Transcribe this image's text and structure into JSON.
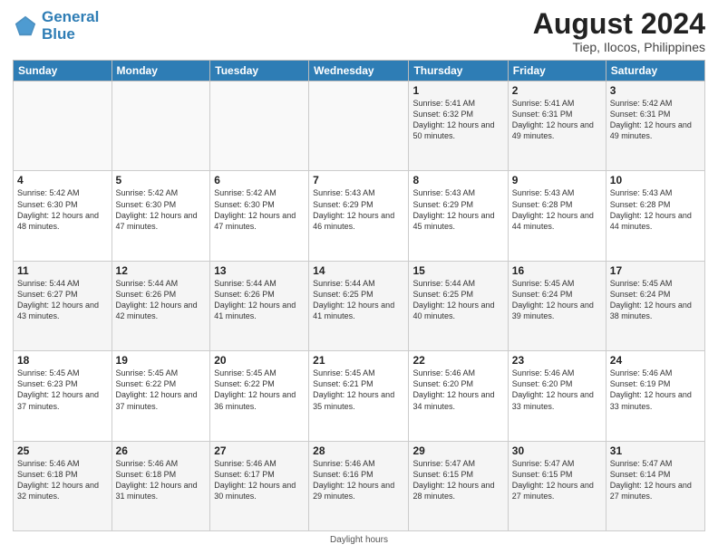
{
  "logo": {
    "text1": "General",
    "text2": "Blue"
  },
  "title": "August 2024",
  "subtitle": "Tiep, Ilocos, Philippines",
  "days_header": [
    "Sunday",
    "Monday",
    "Tuesday",
    "Wednesday",
    "Thursday",
    "Friday",
    "Saturday"
  ],
  "footer_note": "Daylight hours",
  "weeks": [
    [
      {
        "day": "",
        "sunrise": "",
        "sunset": "",
        "daylight": ""
      },
      {
        "day": "",
        "sunrise": "",
        "sunset": "",
        "daylight": ""
      },
      {
        "day": "",
        "sunrise": "",
        "sunset": "",
        "daylight": ""
      },
      {
        "day": "",
        "sunrise": "",
        "sunset": "",
        "daylight": ""
      },
      {
        "day": "1",
        "sunrise": "Sunrise: 5:41 AM",
        "sunset": "Sunset: 6:32 PM",
        "daylight": "Daylight: 12 hours and 50 minutes."
      },
      {
        "day": "2",
        "sunrise": "Sunrise: 5:41 AM",
        "sunset": "Sunset: 6:31 PM",
        "daylight": "Daylight: 12 hours and 49 minutes."
      },
      {
        "day": "3",
        "sunrise": "Sunrise: 5:42 AM",
        "sunset": "Sunset: 6:31 PM",
        "daylight": "Daylight: 12 hours and 49 minutes."
      }
    ],
    [
      {
        "day": "4",
        "sunrise": "Sunrise: 5:42 AM",
        "sunset": "Sunset: 6:30 PM",
        "daylight": "Daylight: 12 hours and 48 minutes."
      },
      {
        "day": "5",
        "sunrise": "Sunrise: 5:42 AM",
        "sunset": "Sunset: 6:30 PM",
        "daylight": "Daylight: 12 hours and 47 minutes."
      },
      {
        "day": "6",
        "sunrise": "Sunrise: 5:42 AM",
        "sunset": "Sunset: 6:30 PM",
        "daylight": "Daylight: 12 hours and 47 minutes."
      },
      {
        "day": "7",
        "sunrise": "Sunrise: 5:43 AM",
        "sunset": "Sunset: 6:29 PM",
        "daylight": "Daylight: 12 hours and 46 minutes."
      },
      {
        "day": "8",
        "sunrise": "Sunrise: 5:43 AM",
        "sunset": "Sunset: 6:29 PM",
        "daylight": "Daylight: 12 hours and 45 minutes."
      },
      {
        "day": "9",
        "sunrise": "Sunrise: 5:43 AM",
        "sunset": "Sunset: 6:28 PM",
        "daylight": "Daylight: 12 hours and 44 minutes."
      },
      {
        "day": "10",
        "sunrise": "Sunrise: 5:43 AM",
        "sunset": "Sunset: 6:28 PM",
        "daylight": "Daylight: 12 hours and 44 minutes."
      }
    ],
    [
      {
        "day": "11",
        "sunrise": "Sunrise: 5:44 AM",
        "sunset": "Sunset: 6:27 PM",
        "daylight": "Daylight: 12 hours and 43 minutes."
      },
      {
        "day": "12",
        "sunrise": "Sunrise: 5:44 AM",
        "sunset": "Sunset: 6:26 PM",
        "daylight": "Daylight: 12 hours and 42 minutes."
      },
      {
        "day": "13",
        "sunrise": "Sunrise: 5:44 AM",
        "sunset": "Sunset: 6:26 PM",
        "daylight": "Daylight: 12 hours and 41 minutes."
      },
      {
        "day": "14",
        "sunrise": "Sunrise: 5:44 AM",
        "sunset": "Sunset: 6:25 PM",
        "daylight": "Daylight: 12 hours and 41 minutes."
      },
      {
        "day": "15",
        "sunrise": "Sunrise: 5:44 AM",
        "sunset": "Sunset: 6:25 PM",
        "daylight": "Daylight: 12 hours and 40 minutes."
      },
      {
        "day": "16",
        "sunrise": "Sunrise: 5:45 AM",
        "sunset": "Sunset: 6:24 PM",
        "daylight": "Daylight: 12 hours and 39 minutes."
      },
      {
        "day": "17",
        "sunrise": "Sunrise: 5:45 AM",
        "sunset": "Sunset: 6:24 PM",
        "daylight": "Daylight: 12 hours and 38 minutes."
      }
    ],
    [
      {
        "day": "18",
        "sunrise": "Sunrise: 5:45 AM",
        "sunset": "Sunset: 6:23 PM",
        "daylight": "Daylight: 12 hours and 37 minutes."
      },
      {
        "day": "19",
        "sunrise": "Sunrise: 5:45 AM",
        "sunset": "Sunset: 6:22 PM",
        "daylight": "Daylight: 12 hours and 37 minutes."
      },
      {
        "day": "20",
        "sunrise": "Sunrise: 5:45 AM",
        "sunset": "Sunset: 6:22 PM",
        "daylight": "Daylight: 12 hours and 36 minutes."
      },
      {
        "day": "21",
        "sunrise": "Sunrise: 5:45 AM",
        "sunset": "Sunset: 6:21 PM",
        "daylight": "Daylight: 12 hours and 35 minutes."
      },
      {
        "day": "22",
        "sunrise": "Sunrise: 5:46 AM",
        "sunset": "Sunset: 6:20 PM",
        "daylight": "Daylight: 12 hours and 34 minutes."
      },
      {
        "day": "23",
        "sunrise": "Sunrise: 5:46 AM",
        "sunset": "Sunset: 6:20 PM",
        "daylight": "Daylight: 12 hours and 33 minutes."
      },
      {
        "day": "24",
        "sunrise": "Sunrise: 5:46 AM",
        "sunset": "Sunset: 6:19 PM",
        "daylight": "Daylight: 12 hours and 33 minutes."
      }
    ],
    [
      {
        "day": "25",
        "sunrise": "Sunrise: 5:46 AM",
        "sunset": "Sunset: 6:18 PM",
        "daylight": "Daylight: 12 hours and 32 minutes."
      },
      {
        "day": "26",
        "sunrise": "Sunrise: 5:46 AM",
        "sunset": "Sunset: 6:18 PM",
        "daylight": "Daylight: 12 hours and 31 minutes."
      },
      {
        "day": "27",
        "sunrise": "Sunrise: 5:46 AM",
        "sunset": "Sunset: 6:17 PM",
        "daylight": "Daylight: 12 hours and 30 minutes."
      },
      {
        "day": "28",
        "sunrise": "Sunrise: 5:46 AM",
        "sunset": "Sunset: 6:16 PM",
        "daylight": "Daylight: 12 hours and 29 minutes."
      },
      {
        "day": "29",
        "sunrise": "Sunrise: 5:47 AM",
        "sunset": "Sunset: 6:15 PM",
        "daylight": "Daylight: 12 hours and 28 minutes."
      },
      {
        "day": "30",
        "sunrise": "Sunrise: 5:47 AM",
        "sunset": "Sunset: 6:15 PM",
        "daylight": "Daylight: 12 hours and 27 minutes."
      },
      {
        "day": "31",
        "sunrise": "Sunrise: 5:47 AM",
        "sunset": "Sunset: 6:14 PM",
        "daylight": "Daylight: 12 hours and 27 minutes."
      }
    ]
  ]
}
